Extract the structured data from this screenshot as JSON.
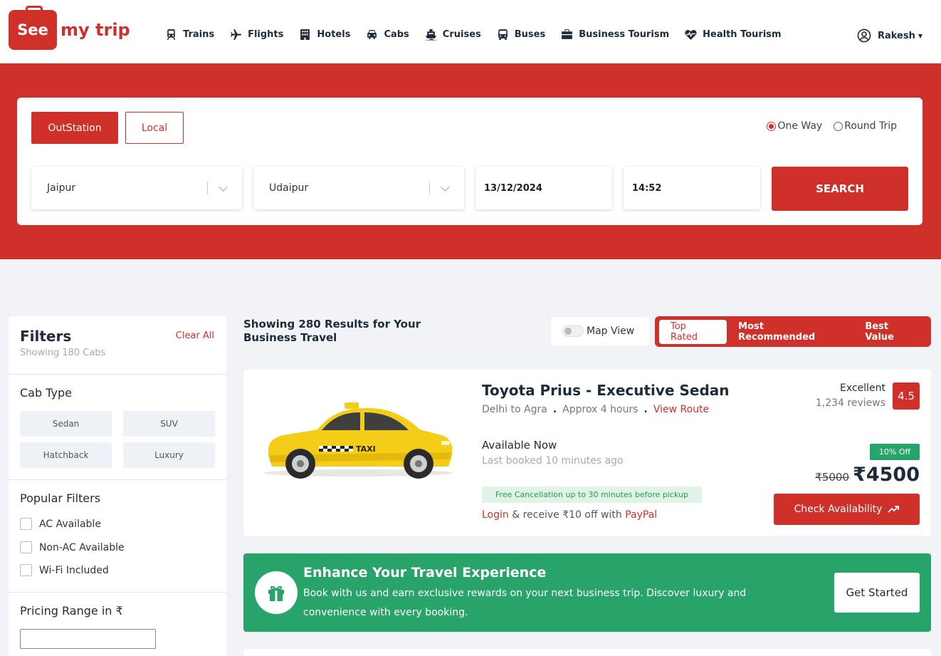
{
  "brand": {
    "logo_box": "See",
    "logo_text": "my trip",
    "accent": "#d0302a"
  },
  "nav": [
    {
      "label": "Trains",
      "icon": "train-icon"
    },
    {
      "label": "Flights",
      "icon": "plane-icon"
    },
    {
      "label": "Hotels",
      "icon": "hotel-icon"
    },
    {
      "label": "Cabs",
      "icon": "car-icon"
    },
    {
      "label": "Cruises",
      "icon": "ship-icon"
    },
    {
      "label": "Buses",
      "icon": "bus-icon"
    },
    {
      "label": "Business Tourism",
      "icon": "briefcase-icon"
    },
    {
      "label": "Health Tourism",
      "icon": "heartbeat-icon"
    }
  ],
  "user": {
    "name": "Rakesh"
  },
  "search": {
    "tabs": {
      "outstation": "OutStation",
      "local": "Local"
    },
    "trip_types": {
      "one_way": "One Way",
      "round_trip": "Round Trip",
      "selected": "One Way"
    },
    "from": "Jaipur",
    "to": "Udaipur",
    "date": "13/12/2024",
    "time": "14:52",
    "button": "SEARCH"
  },
  "filters": {
    "title": "Filters",
    "subtitle": "Showing 180 Cabs",
    "clear": "Clear All",
    "cab_type_title": "Cab Type",
    "cab_types": [
      "Sedan",
      "SUV",
      "Hatchback",
      "Luxury"
    ],
    "popular_title": "Popular Filters",
    "popular": [
      "AC Available",
      "Non-AC Available",
      "Wi-Fi Included"
    ],
    "pricing_title": "Pricing Range in ₹"
  },
  "results": {
    "title": "Showing 280 Results for Your Business Travel",
    "map_view": "Map View",
    "sort": [
      "Top Rated",
      "Most Recommended",
      "Best Value"
    ],
    "sort_active": "Top Rated"
  },
  "car": {
    "name": "Toyota Prius - Executive Sedan",
    "route": "Delhi to Agra",
    "duration": "Approx 4 hours",
    "view_route": "View Route",
    "rating_word": "Excellent",
    "reviews": "1,234 reviews",
    "rating": "4.5",
    "availability": "Available Now",
    "last_booked": "Last booked 10 minutes ago",
    "free_cancel": "Free Cancellation up to 30 minutes before pickup",
    "login": "Login",
    "login_rest": " & receive ₹10 off with ",
    "paypal": "PayPal",
    "discount": "10% Off",
    "old_price": "₹5000",
    "new_price": "₹4500",
    "check_btn": "Check Availability",
    "taxi_sign": "TAXI"
  },
  "promo": {
    "title": "Enhance Your Travel Experience",
    "text": "Book with us and earn exclusive rewards on your next business trip. Discover luxury and convenience with every booking.",
    "button": "Get Started"
  }
}
